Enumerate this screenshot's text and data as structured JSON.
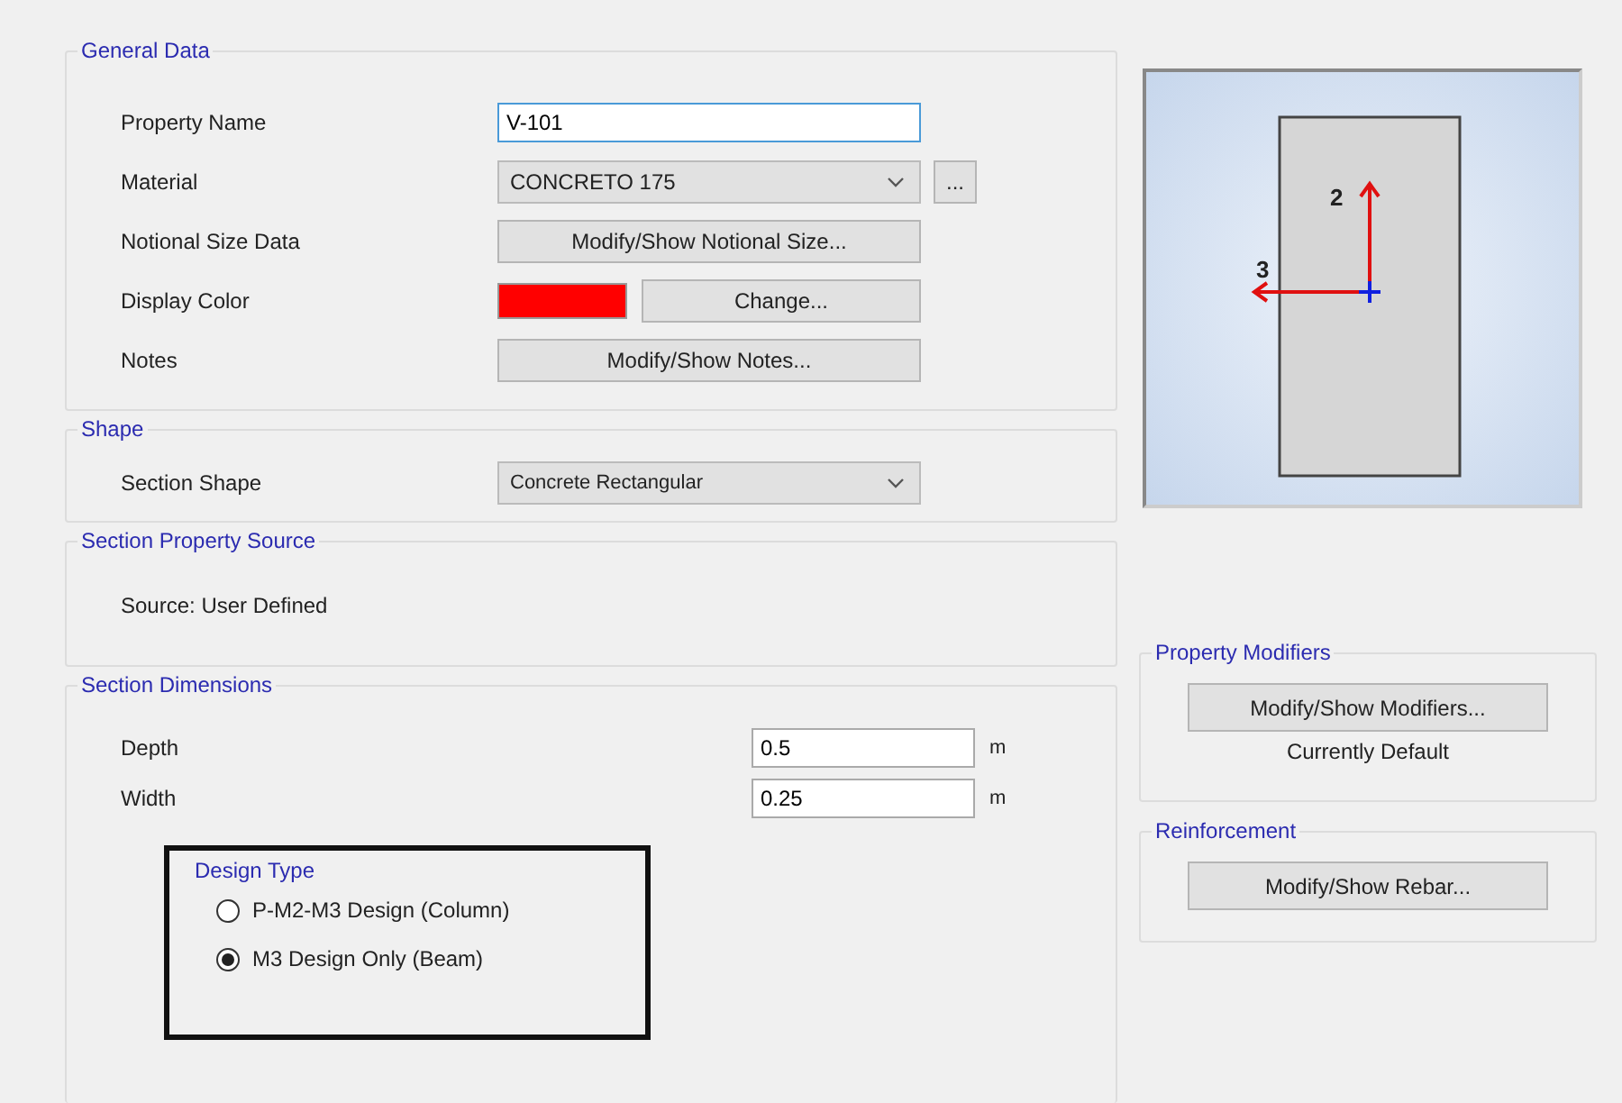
{
  "general": {
    "title": "General Data",
    "rows": [
      {
        "label": "Property Name",
        "kind": "text",
        "value": "V-101"
      },
      {
        "label": "Material",
        "kind": "select",
        "value": "CONCRETO 175",
        "extra": "..."
      },
      {
        "label": "Notional Size Data",
        "kind": "button",
        "button": "Modify/Show Notional Size..."
      },
      {
        "label": "Display Color",
        "kind": "color",
        "color": "#ff0000",
        "button": "Change..."
      },
      {
        "label": "Notes",
        "kind": "button",
        "button": "Modify/Show Notes..."
      }
    ]
  },
  "shape": {
    "title": "Shape",
    "label": "Section Shape",
    "value": "Concrete Rectangular"
  },
  "source": {
    "title": "Section Property Source",
    "text": "Source:  User Defined"
  },
  "dimensions": {
    "title": "Section Dimensions",
    "rows": [
      {
        "label": "Depth",
        "value": "0.5",
        "unit": "m"
      },
      {
        "label": "Width",
        "value": "0.25",
        "unit": "m"
      }
    ],
    "design_type": {
      "title": "Design Type",
      "options": [
        {
          "label": "P-M2-M3 Design  (Column)",
          "selected": false
        },
        {
          "label": "M3 Design Only  (Beam)",
          "selected": true
        }
      ]
    }
  },
  "preview": {
    "axis_vertical": "2",
    "axis_horizontal": "3"
  },
  "modifiers": {
    "title": "Property Modifiers",
    "button": "Modify/Show Modifiers...",
    "status": "Currently Default"
  },
  "reinforcement": {
    "title": "Reinforcement",
    "button": "Modify/Show Rebar..."
  }
}
